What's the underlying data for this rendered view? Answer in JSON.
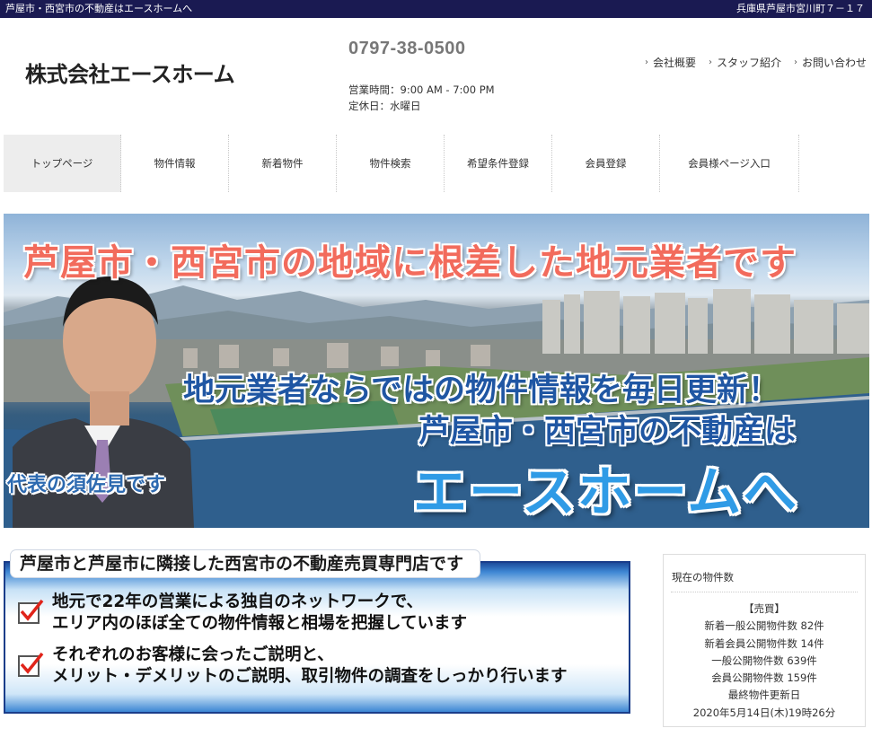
{
  "topbar": {
    "left": "芦屋市・西宮市の不動産はエースホームへ",
    "right": "兵庫県芦屋市宮川町７－１７"
  },
  "header": {
    "company": "株式会社エースホーム",
    "phone": "0797-38-0500",
    "hours": "営業時間：9:00 AM - 7:00 PM",
    "closed": "定休日：水曜日",
    "links": [
      "会社概要",
      "スタッフ紹介",
      "お問い合わせ"
    ]
  },
  "nav": [
    "トップページ",
    "物件情報",
    "新着物件",
    "物件検索",
    "希望条件登録",
    "会員登録",
    "会員様ページ入口"
  ],
  "hero": {
    "line1": "芦屋市・西宮市の地域に根差した地元業者です",
    "line2": "地元業者ならではの物件情報を毎日更新！",
    "line3": "芦屋市・西宮市の不動産は",
    "line4": "エースホームへ",
    "caption": "代表の須佐見です"
  },
  "info": {
    "title": "芦屋市と芦屋市に隣接した西宮市の不動産売買専門店です",
    "items": [
      {
        "l1": "地元で22年の営業による独自のネットワークで、",
        "l2": "エリア内のほぼ全ての物件情報と相場を把握しています"
      },
      {
        "l1": "それぞれのお客様に会ったご説明と、",
        "l2": "メリット・デメリットのご説明、取引物件の調査をしっかり行います"
      }
    ]
  },
  "stats": {
    "header": "現在の物件数",
    "category": "【売買】",
    "lines": [
      "新着一般公開物件数 82件",
      "新着会員公開物件数 14件",
      "一般公開物件数 639件",
      "会員公開物件数 159件",
      "最終物件更新日",
      "2020年5月14日(木)19時26分"
    ]
  },
  "colors": {
    "topbar": "#1a1a52",
    "hero_red": "#f26b5c",
    "hero_blue": "#1f56a3",
    "hero_brand": "#2f9be6",
    "box_border": "#1a3d8a"
  }
}
